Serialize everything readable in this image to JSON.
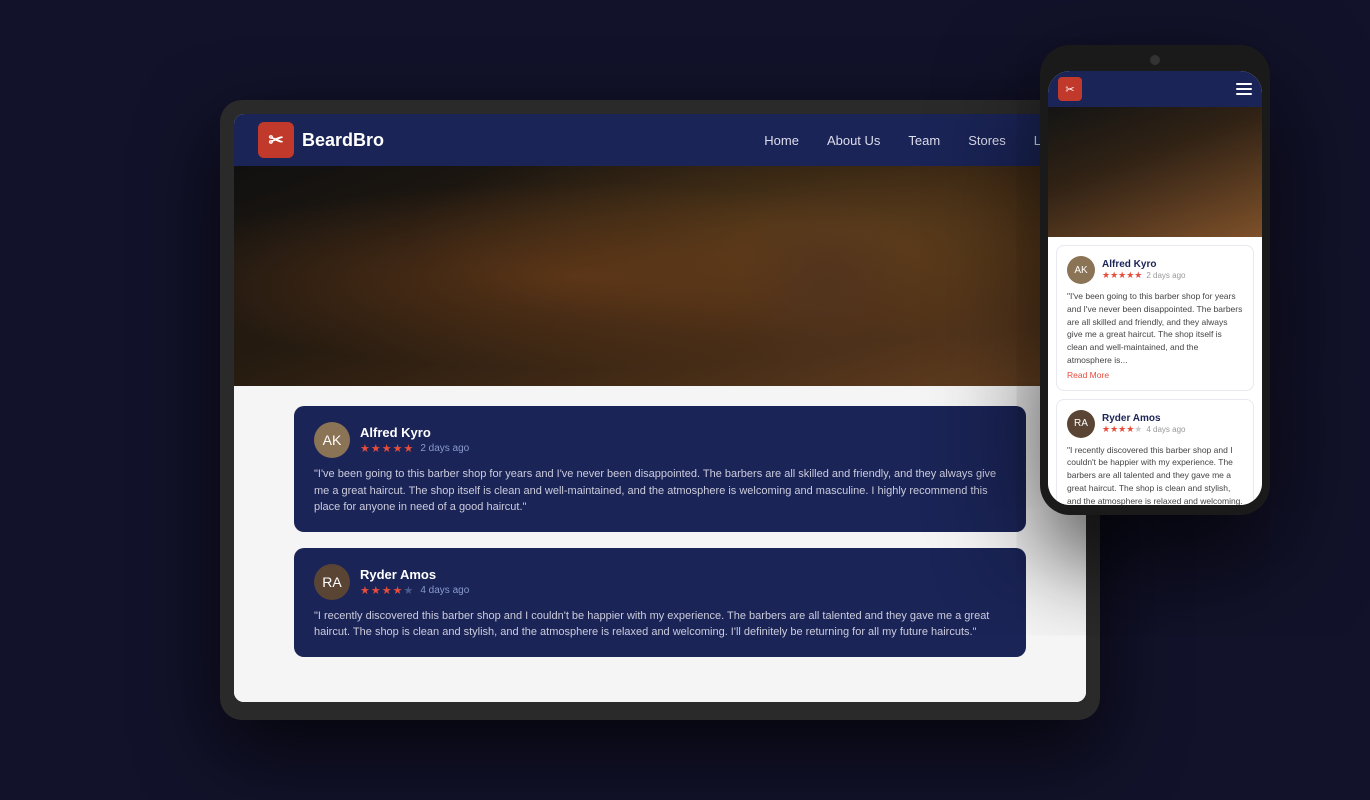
{
  "brand": {
    "name": "BeardBro",
    "icon": "✂"
  },
  "nav": {
    "links": [
      "Home",
      "About Us",
      "Team",
      "Stores",
      "Labs"
    ]
  },
  "reviews": [
    {
      "id": "review-1",
      "name": "Alfred Kyro",
      "time": "2 days ago",
      "stars": 5,
      "text": "\"I've been going to this barber shop for years and I've never been disappointed. The barbers are all skilled and friendly, and they always give me a great haircut. The shop itself is clean and well-maintained, and the atmosphere is welcoming and masculine. I highly recommend this place for anyone in need of a good haircut.\""
    },
    {
      "id": "review-2",
      "name": "Ryder Amos",
      "time": "4 days ago",
      "stars": 4,
      "text": "\"I recently discovered this barber shop and I couldn't be happier with my experience. The barbers are all talented and they gave me a great haircut. The shop is clean and stylish, and the atmosphere is relaxed and welcoming. I'll definitely be returning for all my future haircuts.\""
    }
  ],
  "phone_review_1_short": "\"I've been going to this barber shop for years and I've never been disappointed. The barbers are all skilled and friendly, and they always give me a great haircut. The shop itself is clean and well-maintained, and the atmosphere is...",
  "phone_review_2_short": "\"I recently discovered this barber shop and I couldn't be happier with my experience. The barbers are all talented and they gave me a great haircut. The shop is clean and stylish, and the atmosphere is relaxed and welcoming. I'll definitely be returning for all my future",
  "read_more": "Read More"
}
